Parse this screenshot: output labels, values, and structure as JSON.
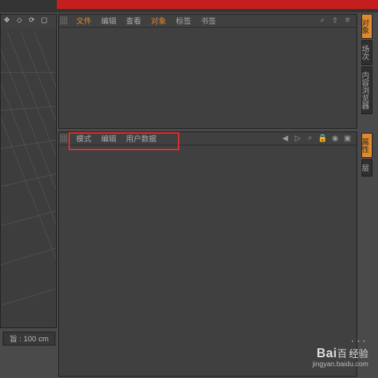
{
  "top_menu": {
    "file": "文件",
    "edit": "编辑",
    "view": "查看",
    "object": "对象",
    "tags": "标签",
    "bookmark": "书签"
  },
  "top_icons": [
    "⌕",
    "⇧",
    "≡"
  ],
  "bottom_menu": {
    "mode": "模式",
    "edit": "编辑",
    "userdata": "用户数据"
  },
  "side_tabs": {
    "top": [
      "对象",
      "场次",
      "内容浏览器"
    ],
    "bot": [
      "属性",
      "层"
    ]
  },
  "ruler_text": "旨 : 100 cm",
  "vp_icons": [
    "✥",
    "◇",
    "⟳",
    "▢"
  ],
  "bot_right_icons": [
    "◀",
    "▷",
    "⌕",
    "🔒",
    "◉",
    "▣"
  ],
  "watermark": {
    "brand": "Bai",
    "brand2": "百",
    "cn": "经验",
    "url": "jingyan.baidu.com"
  }
}
